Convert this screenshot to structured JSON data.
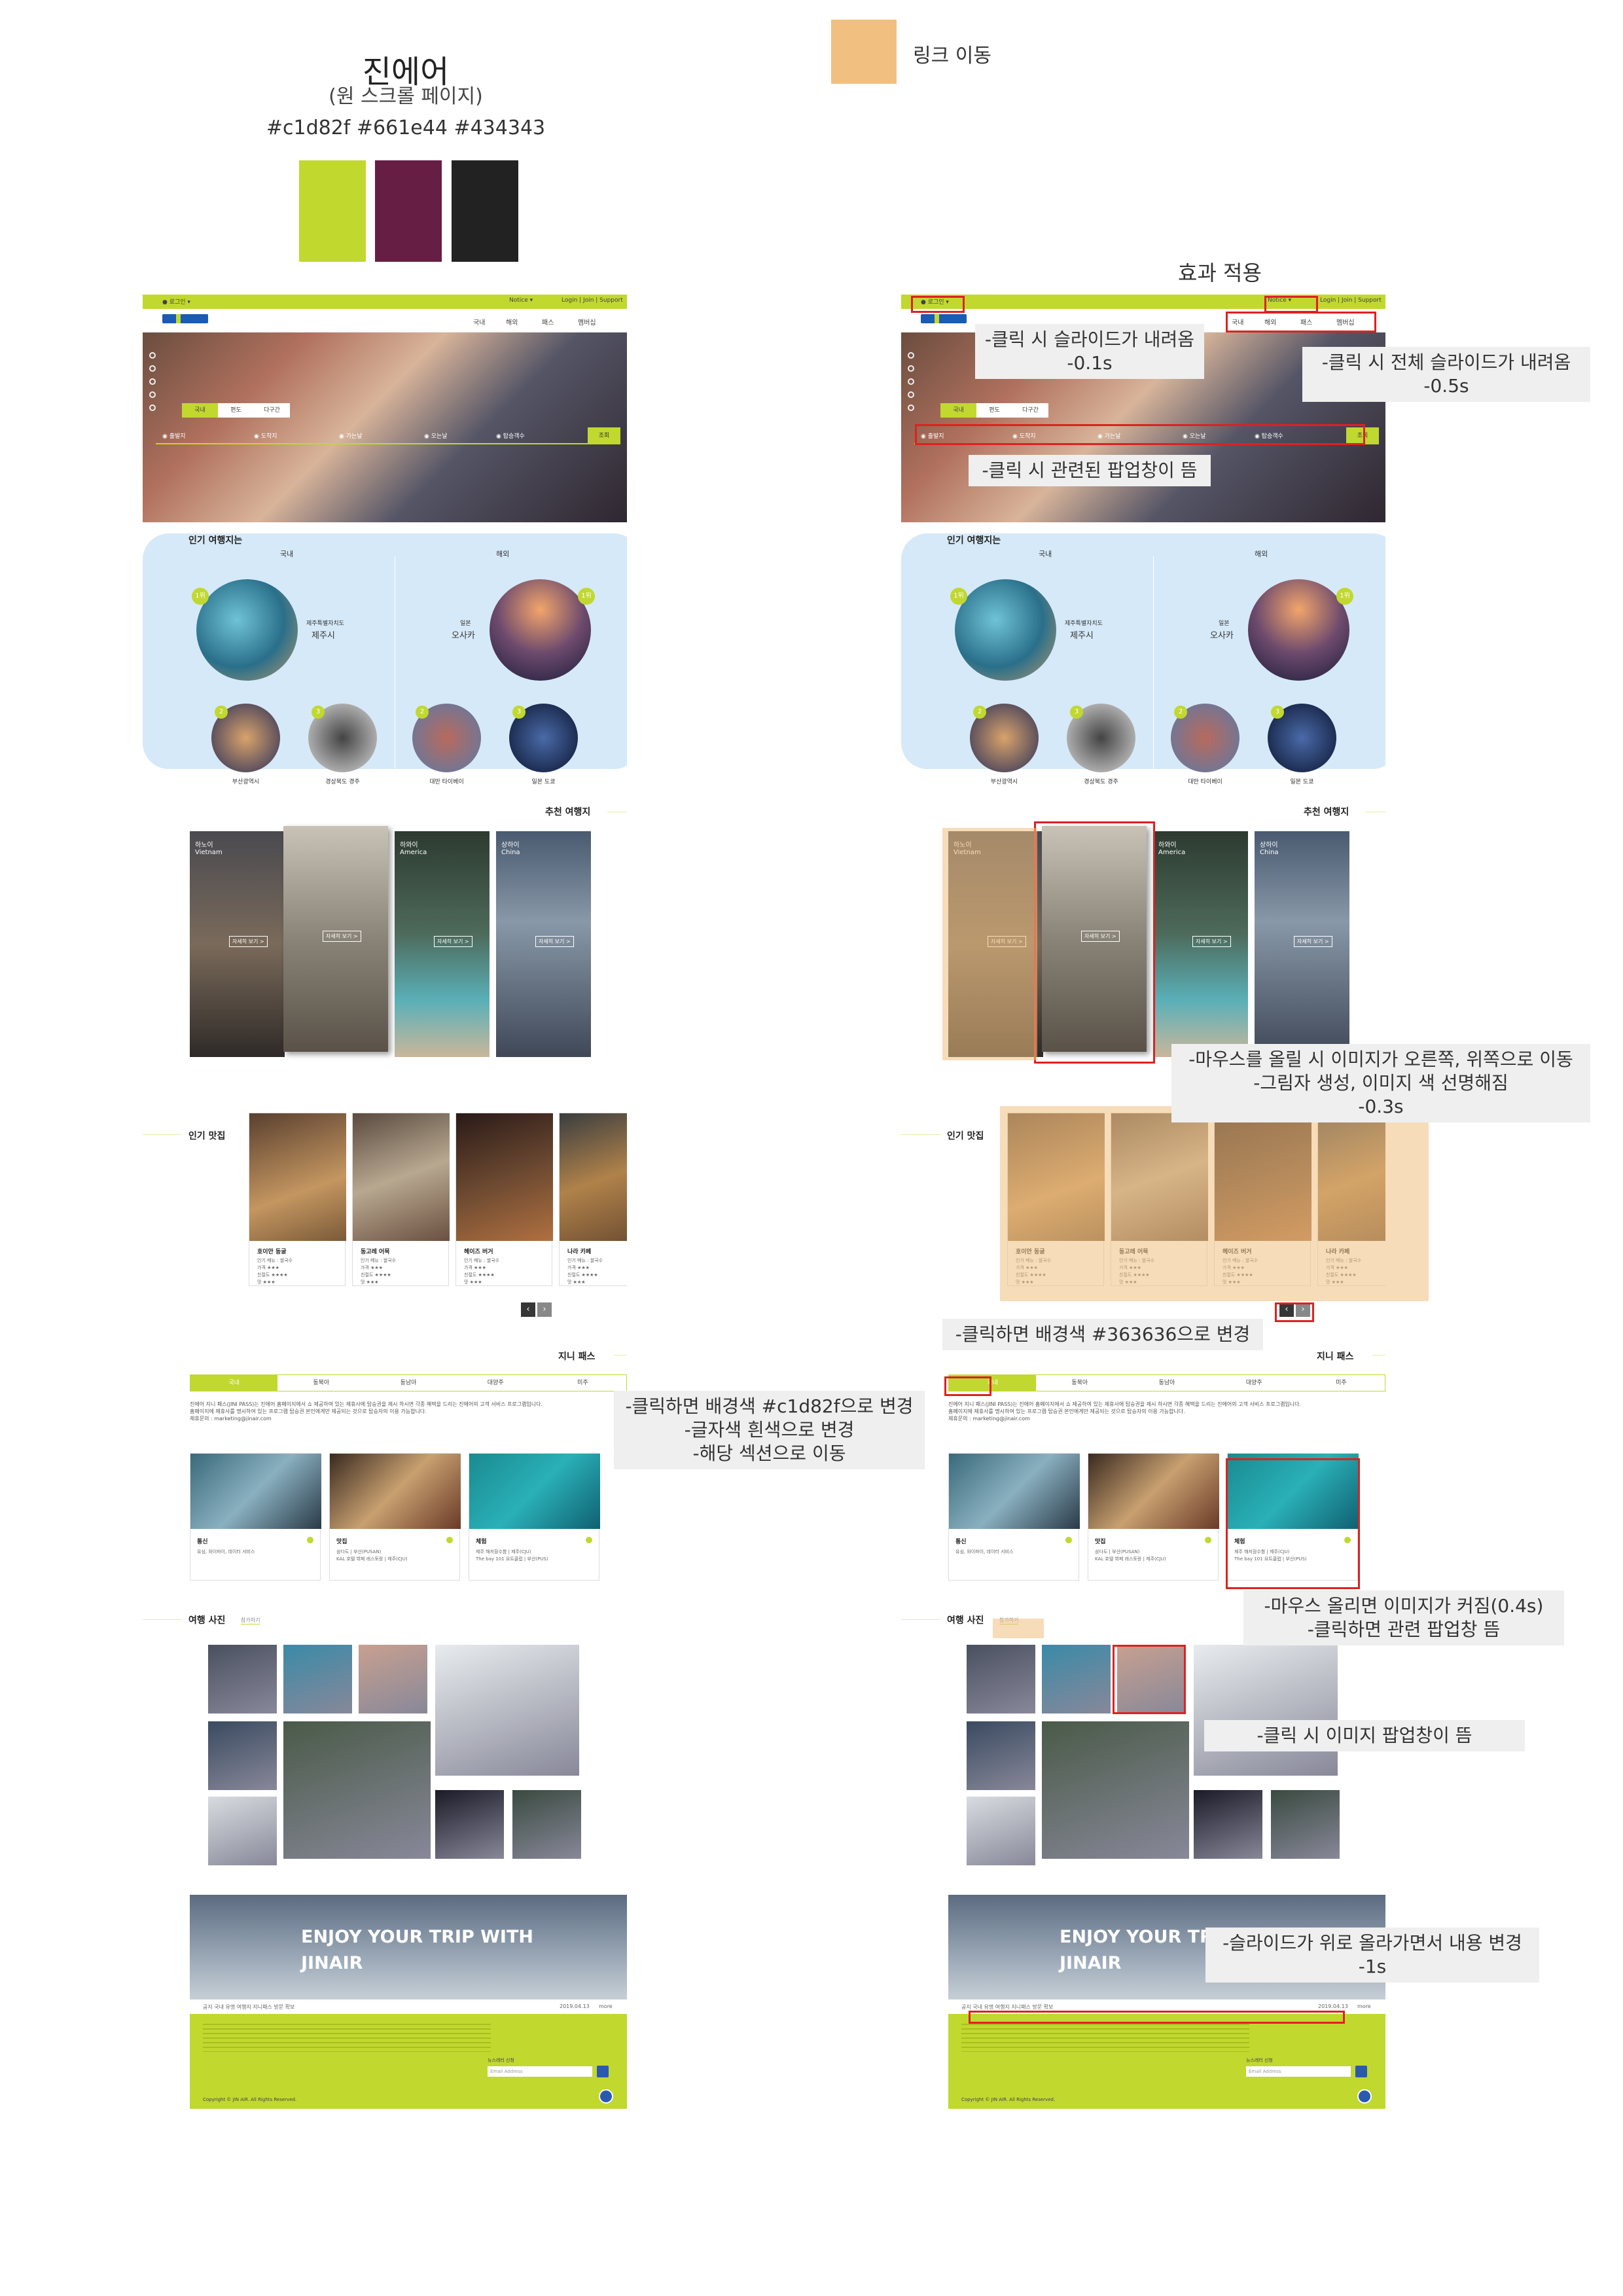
{
  "header": {
    "title": "진에어",
    "subtitle": "(원 스크롤 페이지)",
    "colors_text": "#c1d82f #661e44 #434343"
  },
  "swatches": [
    "#c1d82f",
    "#661e44",
    "#222222"
  ],
  "legend": {
    "label": "링크 이동",
    "color": "#f1bf80"
  },
  "effect_title": "효과 적용",
  "mock": {
    "top_left": "로그인",
    "top_right1": "Notice",
    "top_right2": "Login | Join | Support",
    "menu": [
      "국내",
      "해외",
      "패스",
      "멤버십"
    ],
    "hero_tabs": [
      "국내",
      "편도",
      "다구간"
    ],
    "search_fields": [
      "출발지",
      "도착지",
      "가는날",
      "오는날",
      "탑승객수"
    ],
    "search_btn": "조회",
    "popular_title": "인기 여행지는",
    "domestic": "국내",
    "overseas": "해외",
    "jeju_small": "제주특별자치도",
    "jeju": "제주시",
    "osaka_small": "일본",
    "osaka": "오사카",
    "rank1": "1위",
    "rank2": "2",
    "rank3": "3",
    "small_places": [
      "부산광역시",
      "경상북도 경주",
      "대만 타이베이",
      "일본 도쿄"
    ],
    "reco_title": "추천 여행지",
    "reco": [
      {
        "k": "하노이",
        "e": "Vietnam"
      },
      {
        "k": "",
        "e": ""
      },
      {
        "k": "하와이",
        "e": "America"
      },
      {
        "k": "상하이",
        "e": "China"
      }
    ],
    "reco_more": "자세히 보기 >",
    "food_title": "인기 맛집",
    "foods": [
      "호이안 동굴",
      "동고레 어묵",
      "헤이즈 버거",
      "나라 카페"
    ],
    "food_desc": "인기 메뉴 : 쌀국수\n가격 ★★★\n친절도 ★★★★\n맛 ★★★",
    "pass_title": "지니 패스",
    "pass_tabs": [
      "국내",
      "동북아",
      "동남아",
      "대양주",
      "미주"
    ],
    "pass_text": "진에어 지니 패스(JINI PASS)는 진에어 홈페이지에서 쇼 제공하여 있는 제휴사에 탑승권을 제시 하시면 각종 혜택을 드리는 진에어의 고객 서비스 프로그램입니다.\n홈페이지에 제휴사를 명시하여 있는 프로그램 탑승권 본인에게만 제공되는 것으로 탑승자의 이용 가능합니다.\n제휴문의 : marketing@jinair.com",
    "pass_cards": [
      {
        "n": "통신",
        "d": "유심, 와이파이, 데이터 서비스"
      },
      {
        "n": "맛집",
        "d": "삼다도 | 부산(PUSAN)\nKAL 호텔 뷔페 레스토랑 | 제주(CJU)"
      },
      {
        "n": "체험",
        "d": "제주 해저잠수함 | 제주(CJU)\nThe bay 101 요트클럽 | 부산(PUS)"
      }
    ],
    "photo_title": "여행 사진",
    "photo_more": "참가하기",
    "banner": "ENJOY YOUR TRIP WITH JINAIR",
    "ticker": "공지   국내 유명 여행지 지니패스 방문 확보",
    "ticker_date": "2019.04.13",
    "ticker_more": "more",
    "newsletter": "뉴스레터 신청",
    "email": "Email Address",
    "copyright": "Copyright © JIN AIR. All Rights Reserved."
  },
  "notes": {
    "n1": "-클릭 시 슬라이드가 내려옴\n-0.1s",
    "n2": "-클릭 시 전체 슬라이드가 내려옴\n-0.5s",
    "n3": "-클릭 시 관련된 팝업창이 뜸",
    "n4": "-마우스를 올릴 시 이미지가 오른쪽, 위쪽으로 이동\n-그림자 생성, 이미지 색 선명해짐\n-0.3s",
    "n5": "-클릭하면 배경색 #363636으로 변경",
    "n6": "-클릭하면 배경색 #c1d82f으로 변경\n-글자색 흰색으로 변경\n-해당 섹션으로 이동",
    "n7": "-마우스 올리면 이미지가 커짐(0.4s)\n-클릭하면 관련 팝업창 뜸",
    "n8": "-클릭 시 이미지 팝업창이 뜸",
    "n9": "-슬라이드가 위로 올라가면서 내용 변경\n-1s"
  }
}
